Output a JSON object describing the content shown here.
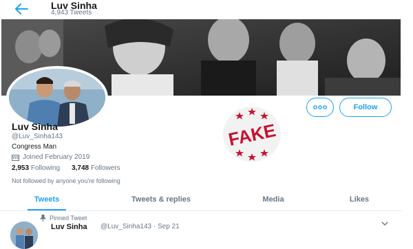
{
  "header": {
    "title": "Luv Sinha",
    "tweets_count": "4,943 Tweets"
  },
  "profile": {
    "name": "Luv Sinha",
    "handle": "@Luv_Sinha143",
    "bio": "Congress Man",
    "joined": "Joined February 2019",
    "following_count": "2,953",
    "following_label": "Following",
    "followers_count": "3,748",
    "followers_label": "Followers",
    "not_followed": "Not followed by anyone you're following"
  },
  "actions": {
    "follow_label": "Follow"
  },
  "tabs": [
    {
      "label": "Tweets",
      "active": true
    },
    {
      "label": "Tweets & replies",
      "active": false
    },
    {
      "label": "Media",
      "active": false
    },
    {
      "label": "Likes",
      "active": false
    }
  ],
  "tweet": {
    "pinned_label": "Pinned Tweet",
    "author": "Luv Sinha",
    "handle_time": "@Luv_Sinha143 · Sep 21"
  },
  "stamp": {
    "text": "FAKE"
  },
  "colors": {
    "accent": "#1da1f2",
    "stamp_red": "#c8102e",
    "muted": "#657786"
  },
  "icons": [
    "back-arrow-icon",
    "more-options-icon",
    "calendar-icon",
    "pin-icon",
    "chevron-down-icon"
  ]
}
